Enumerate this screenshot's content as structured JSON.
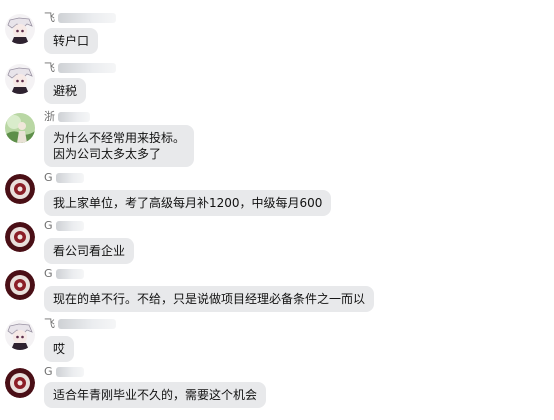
{
  "messages": [
    {
      "sender": "飞",
      "avatar": "anime-avatar-icon",
      "lines": [
        "转户口"
      ]
    },
    {
      "sender": "飞",
      "avatar": "anime-avatar-icon",
      "lines": [
        "避税"
      ]
    },
    {
      "sender": "浙",
      "avatar": "green-avatar-icon",
      "lines": [
        "为什么不经常用来投标。",
        "因为公司太多太多了"
      ]
    },
    {
      "sender": "G",
      "avatar": "round-badge-avatar-icon",
      "lines": [
        "我上家单位，考了高级每月补1200，中级每月600"
      ]
    },
    {
      "sender": "G",
      "avatar": "round-badge-avatar-icon",
      "lines": [
        "看公司看企业"
      ]
    },
    {
      "sender": "G",
      "avatar": "round-badge-avatar-icon",
      "lines": [
        "现在的单不行。不给，只是说做项目经理必备条件之一而以"
      ]
    },
    {
      "sender": "飞",
      "avatar": "anime-avatar-icon",
      "lines": [
        "哎"
      ]
    },
    {
      "sender": "G",
      "avatar": "round-badge-avatar-icon",
      "lines": [
        "适合年青刚毕业不久的，需要这个机会"
      ]
    }
  ],
  "colors": {
    "bubble": "#e8e9eb",
    "name": "#6e6e6e",
    "badge": "#4a0f16"
  }
}
